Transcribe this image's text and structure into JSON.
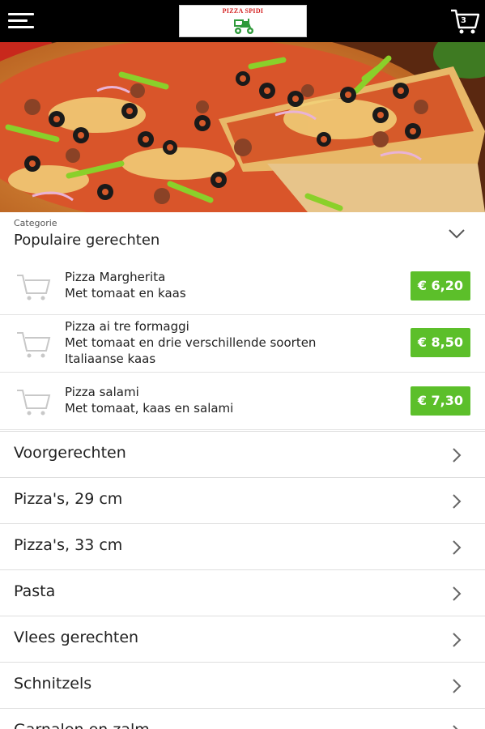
{
  "header": {
    "logo_text": "PIZZA SPIDI",
    "cart_count": "3"
  },
  "category": {
    "label": "Categorie",
    "value": "Populaire gerechten"
  },
  "products": [
    {
      "name": "Pizza Margherita",
      "description": [
        "Met tomaat en kaas"
      ],
      "price": "€ 6,20"
    },
    {
      "name": "Pizza ai tre formaggi",
      "description": [
        "Met tomaat en drie verschillende soorten",
        "Italiaanse kaas"
      ],
      "price": "€ 8,50"
    },
    {
      "name": "Pizza salami",
      "description": [
        "Met tomaat, kaas en salami"
      ],
      "price": "€ 7,30"
    }
  ],
  "categories": [
    {
      "label": "Voorgerechten"
    },
    {
      "label": "Pizza's, 29 cm"
    },
    {
      "label": "Pizza's, 33 cm"
    },
    {
      "label": "Pasta"
    },
    {
      "label": "Vlees gerechten"
    },
    {
      "label": "Schnitzels"
    },
    {
      "label": "Garnalen en zalm"
    }
  ],
  "colors": {
    "topbar": "#000000",
    "price_badge": "#5cbf2a",
    "logo_red": "#d42020"
  }
}
